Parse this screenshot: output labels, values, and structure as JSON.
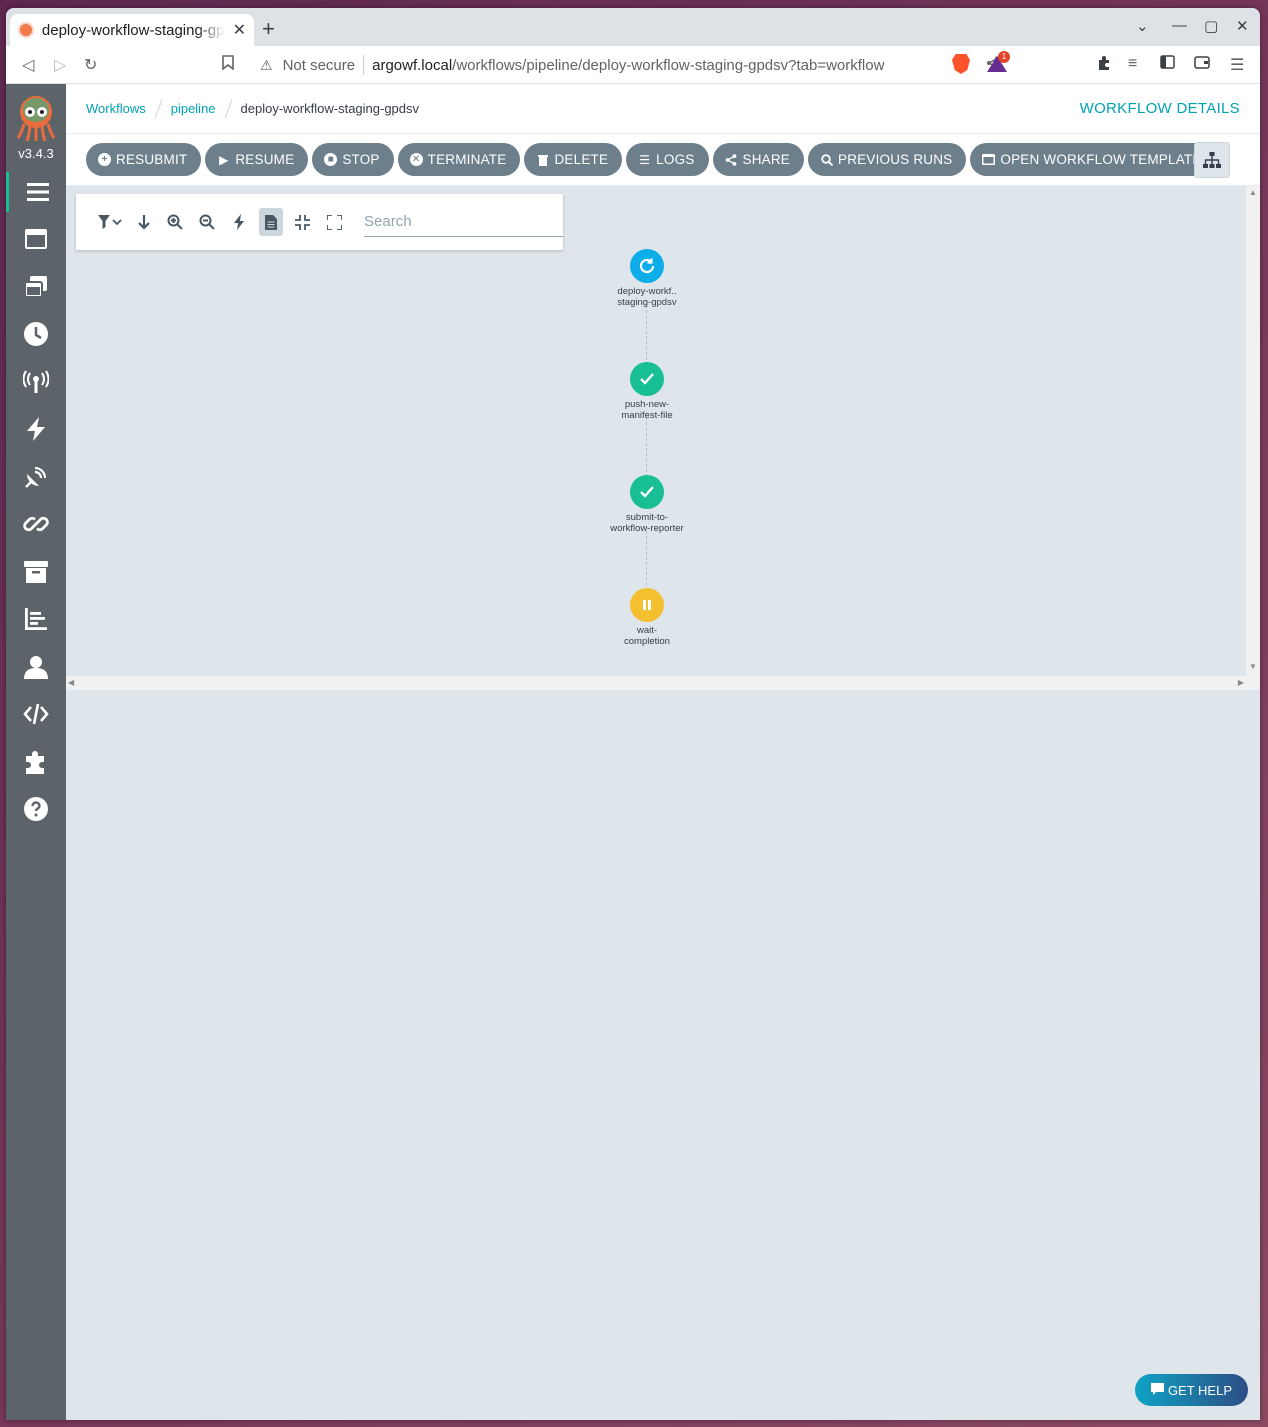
{
  "browser": {
    "tab_title": "deploy-workflow-staging-gpdsv",
    "omnibox": {
      "security_label": "Not secure",
      "host": "argowf.local",
      "path": "/workflows/pipeline/deploy-workflow-staging-gpdsv?tab=workflow"
    },
    "shields_badge": "1"
  },
  "app": {
    "version": "v3.4.3",
    "sidebar": {
      "items": [
        {
          "name": "workflows",
          "icon": "bars-icon",
          "active": true
        },
        {
          "name": "workflow-templates",
          "icon": "window-icon"
        },
        {
          "name": "cluster-workflow-templates",
          "icon": "window-stack-icon"
        },
        {
          "name": "cron-workflows",
          "icon": "clock-icon"
        },
        {
          "name": "event-sources",
          "icon": "broadcast-icon"
        },
        {
          "name": "sensors",
          "icon": "bolt-icon"
        },
        {
          "name": "event-flow",
          "icon": "satellite-icon"
        },
        {
          "name": "event-bindings",
          "icon": "link-icon"
        },
        {
          "name": "archived-workflows",
          "icon": "archive-icon"
        },
        {
          "name": "reports",
          "icon": "chart-icon"
        },
        {
          "name": "user",
          "icon": "user-icon"
        },
        {
          "name": "api-docs",
          "icon": "code-icon"
        },
        {
          "name": "plugins",
          "icon": "puzzle-icon"
        },
        {
          "name": "help",
          "icon": "question-icon"
        }
      ]
    },
    "breadcrumb": {
      "items": [
        "Workflows",
        "pipeline",
        "deploy-workflow-staging-gpdsv"
      ]
    },
    "page_title": "WORKFLOW DETAILS",
    "actions": {
      "resubmit": "RESUBMIT",
      "resume": "RESUME",
      "stop": "STOP",
      "terminate": "TERMINATE",
      "delete": "DELETE",
      "logs": "LOGS",
      "share": "SHARE",
      "previous_runs": "PREVIOUS RUNS",
      "open_template": "OPEN WORKFLOW TEMPLATE"
    },
    "graph": {
      "search_placeholder": "Search",
      "nodes": [
        {
          "line1": "deploy-workf..",
          "line2": "staging-gpdsv",
          "status": "running",
          "color": "#0dadea"
        },
        {
          "line1": "push-new-",
          "line2": "manifest-file",
          "status": "succeeded",
          "color": "#18be94"
        },
        {
          "line1": "submit-to-",
          "line2": "workflow-reporter",
          "status": "succeeded",
          "color": "#18be94"
        },
        {
          "line1": "wait-",
          "line2": "completion",
          "status": "suspended",
          "color": "#f4c030"
        }
      ]
    },
    "help_button": "GET HELP"
  }
}
